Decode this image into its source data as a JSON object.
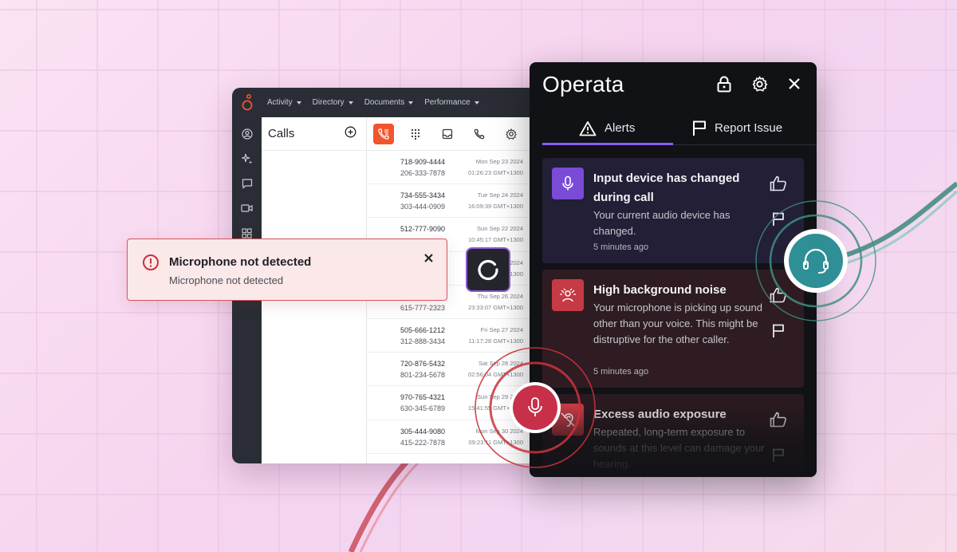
{
  "app": {
    "menu": [
      {
        "label": "Activity"
      },
      {
        "label": "Directory"
      },
      {
        "label": "Documents"
      },
      {
        "label": "Performance"
      }
    ],
    "calls_title": "Calls",
    "rows": [
      {
        "number": "718-909-4444",
        "number2": "206-333-7878",
        "date": "Mon Sep 23 2024",
        "time": "01:26:23 GMT+1300"
      },
      {
        "number": "734-555-3434",
        "number2": "303-444-0909",
        "date": "Tue Sep 24 2024",
        "time": "16:09:39 GMT+1300"
      },
      {
        "number": "512-777-9090",
        "number2": "",
        "date": "Sun Sep 22 2024",
        "time": "10:45:17 GMT+1300"
      },
      {
        "number": "",
        "number2": "",
        "date": "2024",
        "time": "1300"
      },
      {
        "number": "",
        "number2": "615-777-2323",
        "date": "Thu Sep 26 2024",
        "time": "23:33:07 GMT+1300"
      },
      {
        "number": "505-666-1212",
        "number2": "312-888-3434",
        "date": "Fri Sep 27 2024",
        "time": "11:17:28 GMT+1300"
      },
      {
        "number": "720-876-5432",
        "number2": "801-234-5678",
        "date": "Sat Sep 28 2024",
        "time": "02:56:04 GMT+1300"
      },
      {
        "number": "970-765-4321",
        "number2": "630-345-6789",
        "date": "Sun Sep 29 2024",
        "time": "15:41:55 GMT+1300"
      },
      {
        "number": "305-444-9080",
        "number2": "415-222-7878",
        "date": "Mon Sep 30 2024",
        "time": "09:23:11 GMT+1300"
      }
    ]
  },
  "toast": {
    "title": "Microphone not detected",
    "message": "Microphone not detected",
    "accent": "#d7545b"
  },
  "panel": {
    "brand": "Operata",
    "tabs": [
      {
        "label": "Alerts"
      },
      {
        "label": "Report Issue"
      }
    ],
    "accent": "#8b5cf6",
    "alerts": [
      {
        "title": "Input device has changed during call",
        "body": "Your current audio device has changed.",
        "time": "5 minutes ago",
        "icon": "microphone-icon",
        "color": "#7a4bd6"
      },
      {
        "title": "High background noise",
        "body": "Your microphone is picking up sound other than your voice. This might be distruptive for the other caller.",
        "time": "5 minutes ago",
        "icon": "noise-icon",
        "color": "#c53b45"
      },
      {
        "title": "Excess audio exposure",
        "body": "Repeated, long-term exposure to sounds at this level can damage your hearing.",
        "time": "",
        "icon": "ear-icon",
        "color": "#c53b45"
      }
    ]
  }
}
